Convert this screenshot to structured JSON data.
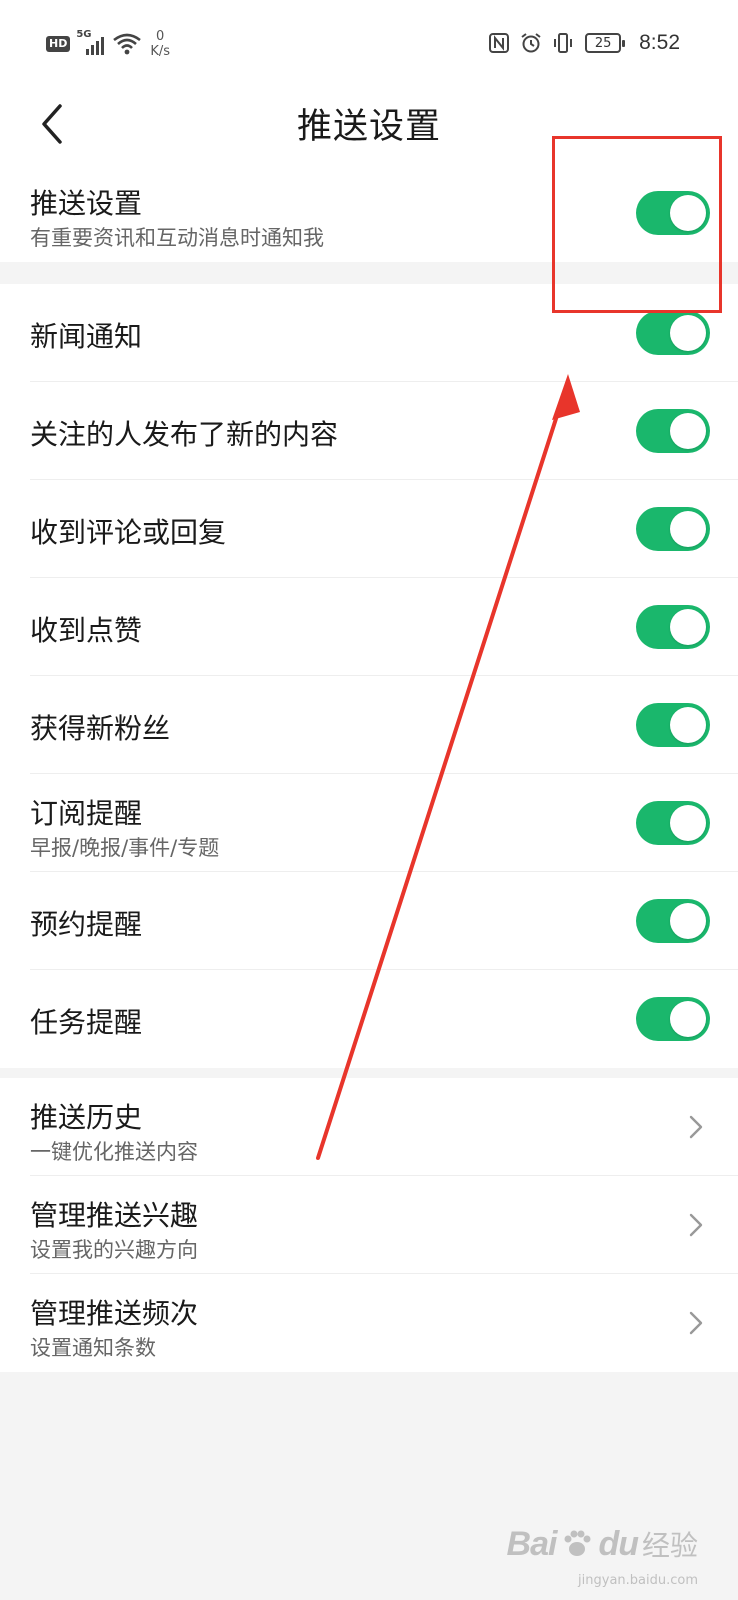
{
  "status_bar": {
    "hd": "HD",
    "network": "5G",
    "speed_value": "0",
    "speed_unit": "K/s",
    "battery": "25",
    "time": "8:52"
  },
  "header": {
    "title": "推送设置"
  },
  "master": {
    "title": "推送设置",
    "subtitle": "有重要资讯和互动消息时通知我",
    "enabled": true
  },
  "toggles": [
    {
      "title": "新闻通知",
      "subtitle": "",
      "enabled": true
    },
    {
      "title": "关注的人发布了新的内容",
      "subtitle": "",
      "enabled": true
    },
    {
      "title": "收到评论或回复",
      "subtitle": "",
      "enabled": true
    },
    {
      "title": "收到点赞",
      "subtitle": "",
      "enabled": true
    },
    {
      "title": "获得新粉丝",
      "subtitle": "",
      "enabled": true
    },
    {
      "title": "订阅提醒",
      "subtitle": "早报/晚报/事件/专题",
      "enabled": true
    },
    {
      "title": "预约提醒",
      "subtitle": "",
      "enabled": true
    },
    {
      "title": "任务提醒",
      "subtitle": "",
      "enabled": true
    }
  ],
  "links": [
    {
      "title": "推送历史",
      "subtitle": "一键优化推送内容"
    },
    {
      "title": "管理推送兴趣",
      "subtitle": "设置我的兴趣方向"
    },
    {
      "title": "管理推送频次",
      "subtitle": "设置通知条数"
    }
  ],
  "colors": {
    "accent": "#1ab76c",
    "annotation": "#e8352b",
    "background": "#f4f4f4"
  },
  "watermark": {
    "brand": "Bai",
    "brand_tail": "du",
    "text": "经验",
    "url": "jingyan.baidu.com"
  }
}
